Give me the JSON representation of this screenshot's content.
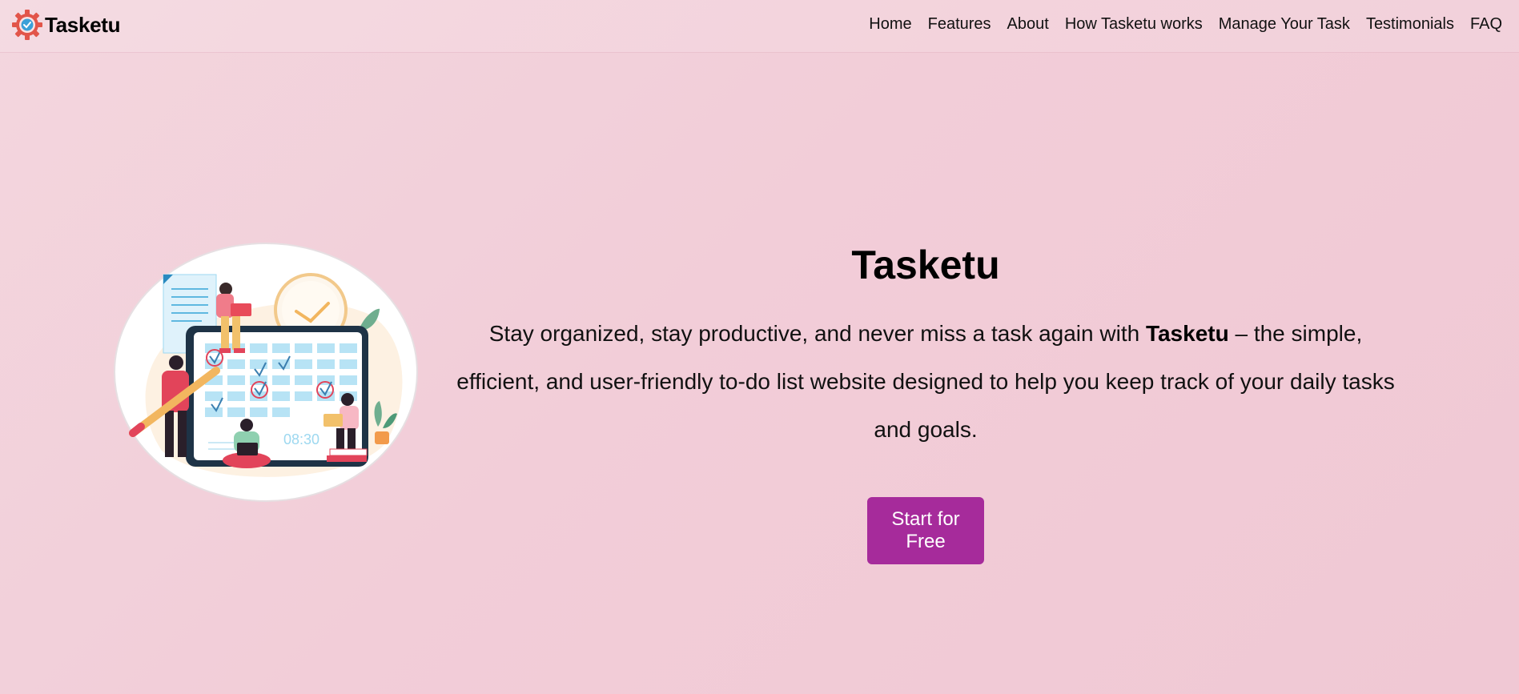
{
  "brand": {
    "name": "Tasketu",
    "logo_icon": "gear-check-icon"
  },
  "nav": {
    "items": [
      {
        "label": "Home"
      },
      {
        "label": "Features"
      },
      {
        "label": "About"
      },
      {
        "label": "How Tasketu works"
      },
      {
        "label": "Manage Your Task"
      },
      {
        "label": "Testimonials"
      },
      {
        "label": "FAQ"
      }
    ]
  },
  "hero": {
    "title": "Tasketu",
    "description_before": "Stay organized, stay productive, and never miss a task again with ",
    "description_bold": "Tasketu",
    "description_after": " – the simple, efficient, and user-friendly to-do list website designed to help you keep track of your daily tasks and goals.",
    "cta_label": "Start for Free",
    "illustration_icon": "task-calendar-illustration",
    "illustration_clock_text": "08:30"
  },
  "colors": {
    "accent": "#a62b9b",
    "background": "#f2cfd9",
    "logo": "#e2554a"
  }
}
